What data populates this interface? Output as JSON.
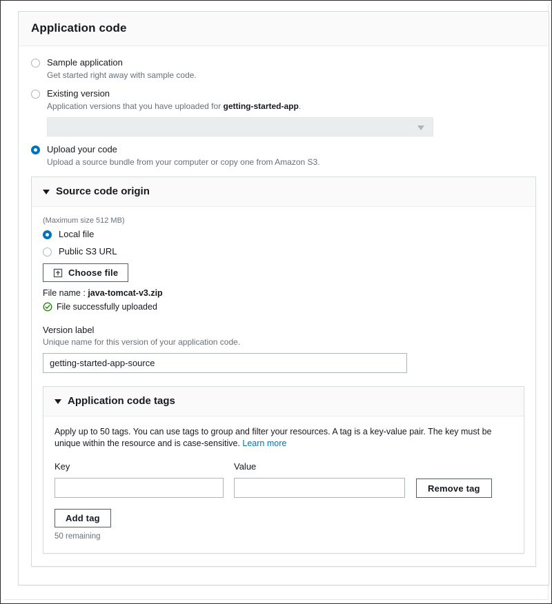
{
  "card": {
    "title": "Application code"
  },
  "code_options": [
    {
      "label": "Sample application",
      "description": "Get started right away with sample code.",
      "selected": false
    },
    {
      "label": "Existing version",
      "description_prefix": "Application versions that you have uploaded for ",
      "description_app": "getting-started-app",
      "description_suffix": ".",
      "selected": false
    },
    {
      "label": "Upload your code",
      "description": "Upload a source bundle from your computer or copy one from Amazon S3.",
      "selected": true
    }
  ],
  "existing_version_select": {
    "value": "",
    "placeholder": "",
    "disabled": true,
    "caret_icon": "chevron-down-icon"
  },
  "source_origin": {
    "title": "Source code origin",
    "expanded": true,
    "max_size_note": "(Maximum size 512 MB)",
    "origin_options": [
      {
        "label": "Local file",
        "selected": true
      },
      {
        "label": "Public S3 URL",
        "selected": false
      }
    ],
    "choose_file_button": {
      "label": "Choose file",
      "icon": "upload-icon"
    },
    "file_name_label": "File name :",
    "file_name_value": "java-tomcat-v3.zip",
    "upload_status": {
      "icon": "check-circle-icon",
      "text": "File successfully uploaded",
      "color": "#1d8102"
    },
    "version_label": {
      "label": "Version label",
      "description": "Unique name for this version of your application code.",
      "value": "getting-started-app-source",
      "placeholder": ""
    }
  },
  "tags": {
    "title": "Application code tags",
    "expanded": true,
    "description": "Apply up to 50 tags. You can use tags to group and filter your resources. A tag is a key-value pair. The key must be unique within the resource and is case-sensitive.",
    "learn_more": "Learn more",
    "key_header": "Key",
    "value_header": "Value",
    "rows": [
      {
        "key": "",
        "value": "",
        "key_placeholder": "",
        "value_placeholder": ""
      }
    ],
    "remove_tag_label": "Remove tag",
    "add_tag_label": "Add tag",
    "remaining": "50 remaining"
  },
  "colors": {
    "accent": "#0073bb",
    "link": "#0073bb",
    "success": "#1d8102",
    "text": "#16191f",
    "muted": "#687078",
    "border": "#d5dbdb",
    "header_bg": "#fafafa",
    "disabled_bg": "#eaeded"
  }
}
